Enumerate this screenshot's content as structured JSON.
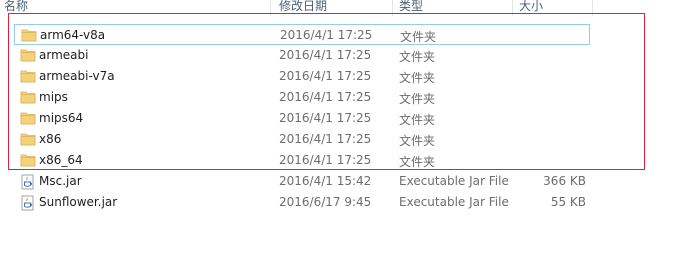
{
  "columns": {
    "name": "名称",
    "date": "修改日期",
    "type": "类型",
    "size": "大小"
  },
  "files": [
    {
      "name": "arm64-v8a",
      "date": "2016/4/1 17:25",
      "type": "文件夹",
      "size": "",
      "icon": "folder-icon"
    },
    {
      "name": "armeabi",
      "date": "2016/4/1 17:25",
      "type": "文件夹",
      "size": "",
      "icon": "folder-icon"
    },
    {
      "name": "armeabi-v7a",
      "date": "2016/4/1 17:25",
      "type": "文件夹",
      "size": "",
      "icon": "folder-icon"
    },
    {
      "name": "mips",
      "date": "2016/4/1 17:25",
      "type": "文件夹",
      "size": "",
      "icon": "folder-icon"
    },
    {
      "name": "mips64",
      "date": "2016/4/1 17:25",
      "type": "文件夹",
      "size": "",
      "icon": "folder-icon"
    },
    {
      "name": "x86",
      "date": "2016/4/1 17:25",
      "type": "文件夹",
      "size": "",
      "icon": "folder-icon"
    },
    {
      "name": "x86_64",
      "date": "2016/4/1 17:25",
      "type": "文件夹",
      "size": "",
      "icon": "folder-icon"
    },
    {
      "name": "Msc.jar",
      "date": "2016/4/1 15:42",
      "type": "Executable Jar File",
      "size": "366 KB",
      "icon": "jar-file-icon"
    },
    {
      "name": "Sunflower.jar",
      "date": "2016/6/17 9:45",
      "type": "Executable Jar File",
      "size": "55 KB",
      "icon": "jar-file-icon"
    }
  ],
  "colors": {
    "folder": "#f4d27a",
    "selection_highlight": "#e0203a",
    "focus_border": "#99c9ef"
  }
}
